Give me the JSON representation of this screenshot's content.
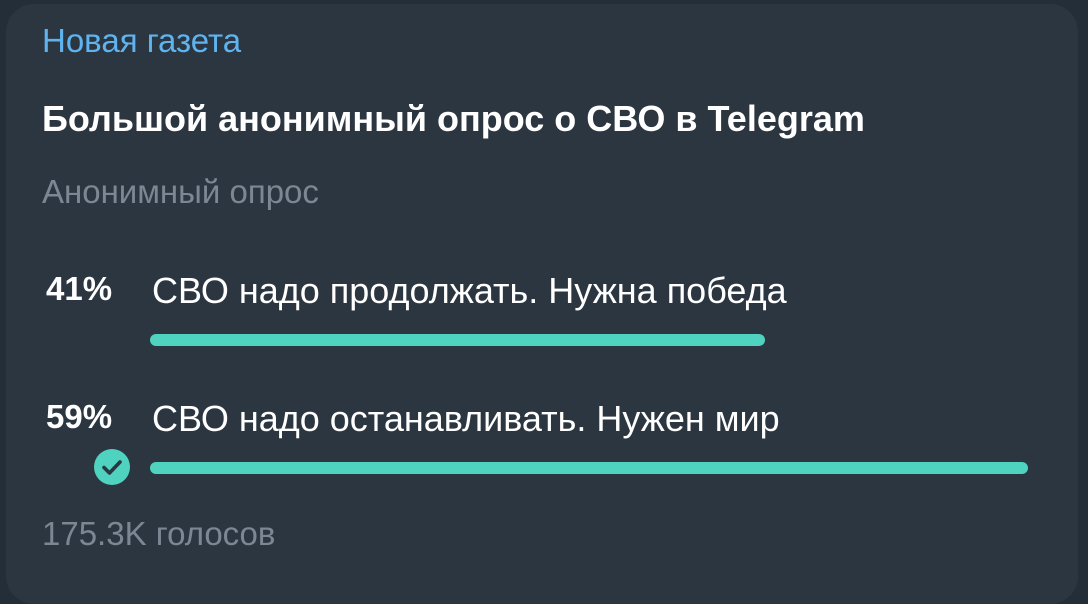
{
  "channel": {
    "name": "Новая газета"
  },
  "poll": {
    "question": "Большой анонимный опрос о СВО в Telegram",
    "type_label": "Анонимный опрос",
    "options": [
      {
        "percent": "41%",
        "fraction": 0.7,
        "label": "СВО надо продолжать. Нужна победа",
        "selected": false
      },
      {
        "percent": "59%",
        "fraction": 1.0,
        "label": "СВО надо останавливать. Нужен мир",
        "selected": true
      }
    ],
    "votes": "175.3K голосов"
  },
  "colors": {
    "accent": "#4fd2bf",
    "channel_name": "#5fb4f0",
    "bubble": "#2c3641",
    "muted_text": "#7b8894"
  },
  "icons": {
    "selected_mark": "check-circle-icon"
  }
}
